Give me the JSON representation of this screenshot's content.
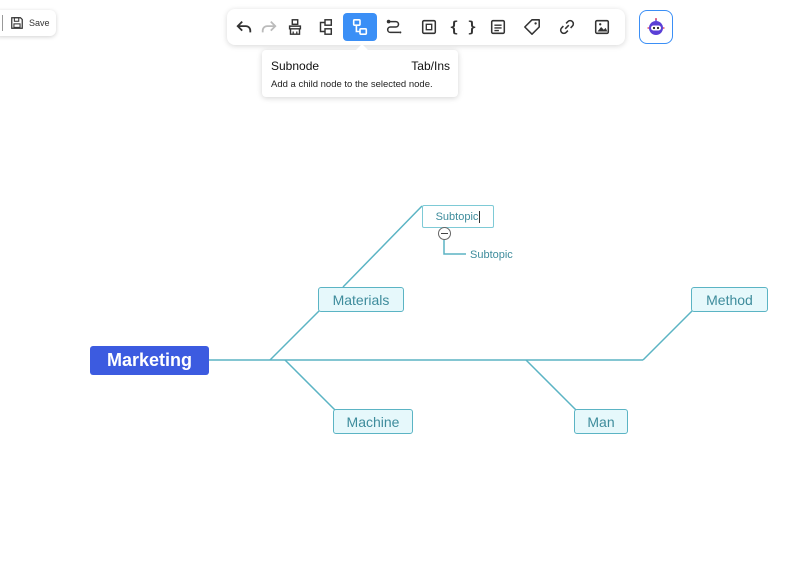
{
  "save": {
    "label": "Save",
    "icon": "save-icon"
  },
  "toolbar": {
    "buttons": [
      {
        "name": "undo",
        "icon": "undo-icon",
        "state": "enabled"
      },
      {
        "name": "redo",
        "icon": "redo-icon",
        "state": "disabled"
      },
      {
        "name": "format-painter",
        "icon": "format-painter-icon",
        "state": "enabled"
      },
      {
        "name": "sibling-node",
        "icon": "sibling-node-icon",
        "state": "enabled"
      },
      {
        "name": "subnode",
        "icon": "subnode-icon",
        "state": "active"
      },
      {
        "name": "relation-line",
        "icon": "relation-line-icon",
        "state": "enabled"
      },
      {
        "name": "summary",
        "icon": "summary-icon",
        "state": "enabled"
      },
      {
        "name": "formula",
        "icon": "braces-icon",
        "state": "enabled",
        "text": "{ }"
      },
      {
        "name": "note",
        "icon": "note-icon",
        "state": "enabled"
      },
      {
        "name": "tag",
        "icon": "tag-icon",
        "state": "enabled"
      },
      {
        "name": "link",
        "icon": "link-icon",
        "state": "enabled"
      },
      {
        "name": "image",
        "icon": "image-icon",
        "state": "enabled"
      }
    ],
    "ai_button": {
      "icon": "robot-icon"
    }
  },
  "tooltip": {
    "title": "Subnode",
    "shortcut": "Tab/Ins",
    "description": "Add a child node to the selected node."
  },
  "mindmap": {
    "root": "Marketing",
    "topics": {
      "materials": "Materials",
      "machine": "Machine",
      "method": "Method",
      "man": "Man"
    },
    "subtopic_editing": "Subtopic",
    "subtopic_child": "Subtopic"
  },
  "colors": {
    "accent": "#3b8ff6",
    "root_fill": "#3c5be0",
    "line": "#5bb4c4",
    "topic_fill": "#e6f8fb",
    "topic_text": "#3e8c9c"
  }
}
